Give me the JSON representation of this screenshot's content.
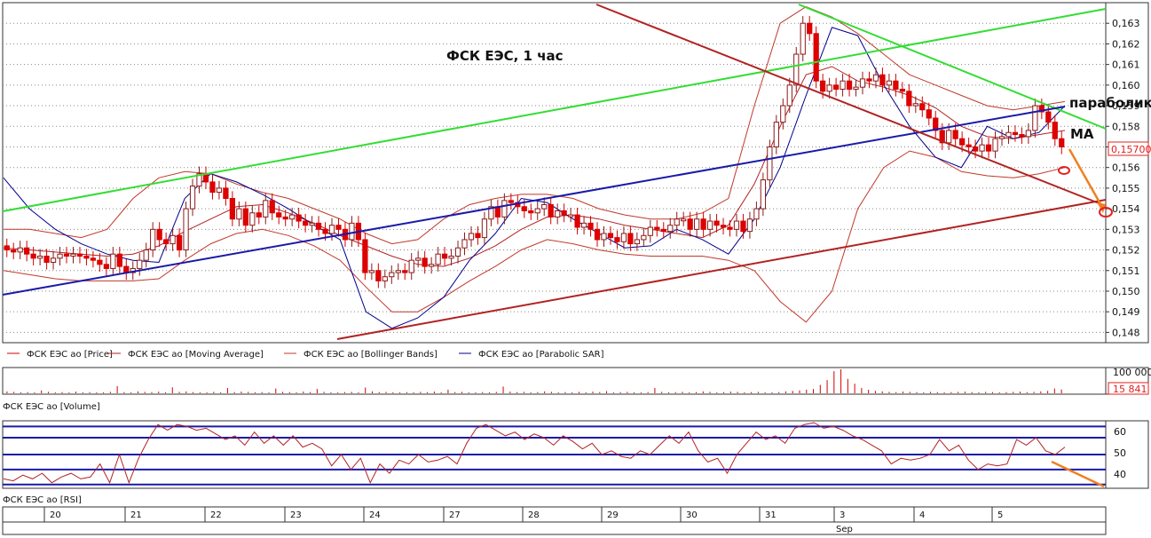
{
  "chart_data": [
    {
      "panel": "price",
      "type": "candlestick",
      "title": "ФСК ЕЭС, 1 час",
      "ylim": [
        0.1475,
        0.164
      ],
      "y_ticks": [
        "0,163",
        "0,162",
        "0,161",
        "0,160",
        "0,159",
        "0,158",
        "0,157",
        "0,156",
        "0,155",
        "0,154",
        "0,153",
        "0,152",
        "0,151",
        "0,150",
        "0,149",
        "0,148"
      ],
      "last_price_label": "0,15700",
      "annotations": [
        "параболик",
        "MA"
      ],
      "legend": [
        {
          "name": "ФСК ЕЭС ао [Price]",
          "color": "#d40000"
        },
        {
          "name": "ФСК ЕЭС ао [Moving Average]",
          "color": "#b22222"
        },
        {
          "name": "ФСК ЕЭС ао [Bollinger Bands]",
          "color": "#c0392b"
        },
        {
          "name": "ФСК ЕЭС ао [Parabolic SAR]",
          "color": "#00008b"
        }
      ],
      "close_series": [
        0.152,
        0.1519,
        0.1521,
        0.1518,
        0.1516,
        0.1517,
        0.1514,
        0.1516,
        0.1518,
        0.1517,
        0.1518,
        0.1517,
        0.1516,
        0.1515,
        0.1513,
        0.1511,
        0.1518,
        0.1512,
        0.1509,
        0.1511,
        0.1515,
        0.152,
        0.153,
        0.1525,
        0.1523,
        0.1527,
        0.152,
        0.154,
        0.1551,
        0.1557,
        0.1553,
        0.1548,
        0.155,
        0.1545,
        0.1535,
        0.154,
        0.1532,
        0.1538,
        0.1536,
        0.1544,
        0.1538,
        0.1536,
        0.1535,
        0.1537,
        0.1534,
        0.1532,
        0.1533,
        0.153,
        0.1528,
        0.1532,
        0.153,
        0.1525,
        0.1533,
        0.1525,
        0.1509,
        0.151,
        0.1505,
        0.1507,
        0.1509,
        0.151,
        0.1509,
        0.1515,
        0.1516,
        0.1512,
        0.1513,
        0.1518,
        0.1516,
        0.1517,
        0.1521,
        0.1525,
        0.1528,
        0.1526,
        0.1535,
        0.1541,
        0.1536,
        0.1544,
        0.1543,
        0.1541,
        0.1539,
        0.1538,
        0.154,
        0.1542,
        0.1536,
        0.1539,
        0.1537,
        0.1537,
        0.1531,
        0.1533,
        0.153,
        0.1525,
        0.1528,
        0.1526,
        0.1524,
        0.1528,
        0.1523,
        0.1525,
        0.1527,
        0.1531,
        0.153,
        0.1529,
        0.1532,
        0.1535,
        0.1535,
        0.153,
        0.1535,
        0.153,
        0.1534,
        0.1532,
        0.1531,
        0.153,
        0.1534,
        0.1529,
        0.1535,
        0.154,
        0.1554,
        0.157,
        0.1582,
        0.159,
        0.16,
        0.1615,
        0.163,
        0.1625,
        0.1602,
        0.1597,
        0.16,
        0.1598,
        0.1602,
        0.1598,
        0.1599,
        0.1603,
        0.1602,
        0.1605,
        0.16,
        0.1602,
        0.1598,
        0.1597,
        0.159,
        0.1591,
        0.1588,
        0.1584,
        0.1578,
        0.1572,
        0.1578,
        0.1574,
        0.1571,
        0.157,
        0.1568,
        0.1571,
        0.1568,
        0.1574,
        0.1575,
        0.1577,
        0.1576,
        0.1575,
        0.1578,
        0.159,
        0.1587,
        0.1582,
        0.1574,
        0.157
      ],
      "series": [
        {
          "name": "ФСК ЕЭС ао [Moving Average]",
          "values": [
            0.1521,
            0.152,
            0.1519,
            0.1518,
            0.1517,
            0.1518,
            0.1522,
            0.1529,
            0.1535,
            0.1541,
            0.1542,
            0.1538,
            0.1533,
            0.1527,
            0.1522,
            0.1517,
            0.1513,
            0.1512,
            0.1516,
            0.1522,
            0.153,
            0.1536,
            0.1537,
            0.1535,
            0.1532,
            0.153,
            0.1528,
            0.1526,
            0.1532,
            0.1552,
            0.158,
            0.1605,
            0.1609,
            0.1602,
            0.1599,
            0.1595,
            0.1589,
            0.158,
            0.1575,
            0.1574,
            0.1576,
            0.1578
          ]
        },
        {
          "name": "ФСК ЕЭС ао [Bollinger Bands] upper",
          "values": [
            0.153,
            0.153,
            0.1528,
            0.1526,
            0.153,
            0.1545,
            0.1555,
            0.1558,
            0.1557,
            0.1552,
            0.1548,
            0.1545,
            0.154,
            0.1535,
            0.1528,
            0.1523,
            0.1525,
            0.1535,
            0.1542,
            0.1545,
            0.1547,
            0.1547,
            0.1545,
            0.154,
            0.1537,
            0.1535,
            0.1535,
            0.1538,
            0.1545,
            0.159,
            0.163,
            0.1638,
            0.1633,
            0.1625,
            0.1615,
            0.1605,
            0.16,
            0.1595,
            0.159,
            0.1588,
            0.159,
            0.1592
          ]
        },
        {
          "name": "ФСК ЕЭС ао [Bollinger Bands] lower",
          "values": [
            0.151,
            0.1508,
            0.1506,
            0.1505,
            0.1505,
            0.1505,
            0.1506,
            0.1515,
            0.1523,
            0.1528,
            0.153,
            0.1527,
            0.1522,
            0.1515,
            0.1502,
            0.149,
            0.149,
            0.1497,
            0.1505,
            0.1512,
            0.152,
            0.1525,
            0.1523,
            0.152,
            0.1518,
            0.1517,
            0.1517,
            0.1517,
            0.1515,
            0.151,
            0.1495,
            0.1485,
            0.15,
            0.154,
            0.156,
            0.1568,
            0.1565,
            0.1558,
            0.1556,
            0.1555,
            0.1557,
            0.156
          ]
        },
        {
          "name": "ФСК ЕЭС ао [Parabolic SAR]",
          "values": [
            0.1555,
            0.154,
            0.153,
            0.1523,
            0.1518,
            0.1515,
            0.1514,
            0.1545,
            0.1557,
            0.1553,
            0.1547,
            0.154,
            0.1532,
            0.1525,
            0.149,
            0.1482,
            0.1487,
            0.1497,
            0.1515,
            0.1528,
            0.1545,
            0.1543,
            0.1535,
            0.1528,
            0.1521,
            0.1522,
            0.153,
            0.1525,
            0.1518,
            0.1535,
            0.156,
            0.1595,
            0.1628,
            0.1624,
            0.16,
            0.158,
            0.1565,
            0.156,
            0.158,
            0.1574,
            0.1577,
            0.159
          ]
        }
      ]
    },
    {
      "panel": "volume",
      "type": "bar",
      "ylabel_ticks": [
        "100 000"
      ],
      "last_value_label": "15 841",
      "legend": [
        {
          "name": "ФСК ЕЭС ао [Volume]"
        }
      ],
      "values": [
        8000,
        6000,
        4000,
        5000,
        3000,
        12000,
        6000,
        4000,
        5000,
        3000,
        7000,
        4000,
        5000,
        3000,
        4000,
        6000,
        30000,
        5000,
        4000,
        8000,
        6000,
        5000,
        7000,
        4000,
        25000,
        6000,
        8000,
        5000,
        4000,
        3000,
        6000,
        4000,
        22000,
        5000,
        7000,
        6000,
        4000,
        5000,
        3000,
        20000,
        6000,
        5000,
        4000,
        7000,
        5000,
        18000,
        6000,
        4000,
        3000,
        5000,
        6000,
        4000,
        24000,
        8000,
        5000,
        6000,
        4000,
        3000,
        5000,
        4000,
        6000,
        5000,
        7000,
        4000,
        15000,
        5000,
        6000,
        4000,
        3000,
        5000,
        4000,
        6000,
        28000,
        7000,
        5000,
        6000,
        4000,
        5000,
        8000,
        6000,
        4000,
        5000,
        3000,
        6000,
        4000,
        7000,
        5000,
        9000,
        4000,
        5000,
        6000,
        4000,
        3000,
        5000,
        22000,
        6000,
        4000,
        5000,
        6000,
        4000,
        5000,
        8000,
        6000,
        4000,
        5000,
        7000,
        6000,
        4000,
        5000,
        6000,
        4000,
        3000,
        5000,
        8000,
        10000,
        12000,
        15000,
        18000,
        35000,
        55000,
        92000,
        100000,
        60000,
        40000,
        22000,
        15000,
        10000,
        8000,
        6000,
        5000,
        7000,
        6000,
        5000,
        4000,
        6000,
        5000,
        4000,
        5000,
        6000,
        7000,
        5000,
        4000,
        6000,
        5000,
        4000,
        5000,
        6000,
        7000,
        5000,
        6000,
        8000,
        10000,
        20000,
        15841
      ]
    },
    {
      "panel": "rsi",
      "type": "line",
      "y_ticks": [
        "60",
        "50",
        "40"
      ],
      "levels": [
        65,
        59,
        50,
        42,
        34
      ],
      "ylim": [
        32,
        68
      ],
      "legend": [
        {
          "name": "ФСК ЕЭС ао [RSI]"
        }
      ],
      "values": [
        37,
        36,
        39,
        37,
        40,
        35,
        38,
        40,
        37,
        38,
        45,
        35,
        50,
        35,
        48,
        58,
        66,
        63,
        66,
        65,
        63,
        64,
        61,
        58,
        60,
        55,
        62,
        56,
        60,
        55,
        60,
        54,
        56,
        53,
        44,
        50,
        42,
        48,
        35,
        45,
        40,
        47,
        45,
        50,
        46,
        47,
        49,
        45,
        56,
        64,
        66,
        63,
        60,
        62,
        58,
        61,
        59,
        55,
        60,
        57,
        53,
        56,
        50,
        52,
        49,
        48,
        52,
        50,
        55,
        60,
        56,
        62,
        52,
        46,
        48,
        40,
        50,
        56,
        62,
        58,
        60,
        56,
        64,
        66,
        67,
        64,
        65,
        63,
        60,
        58,
        55,
        52,
        45,
        48,
        47,
        48,
        50,
        58,
        52,
        55,
        47,
        42,
        45,
        44,
        45,
        58,
        55,
        59,
        52,
        50,
        54
      ]
    },
    {
      "panel": "time_axis",
      "type": "axis",
      "day_labels": [
        "20",
        "21",
        "22",
        "23",
        "24",
        "27",
        "28",
        "29",
        "30",
        "31",
        "3",
        "4",
        "5"
      ],
      "month_label": "Sep"
    }
  ]
}
